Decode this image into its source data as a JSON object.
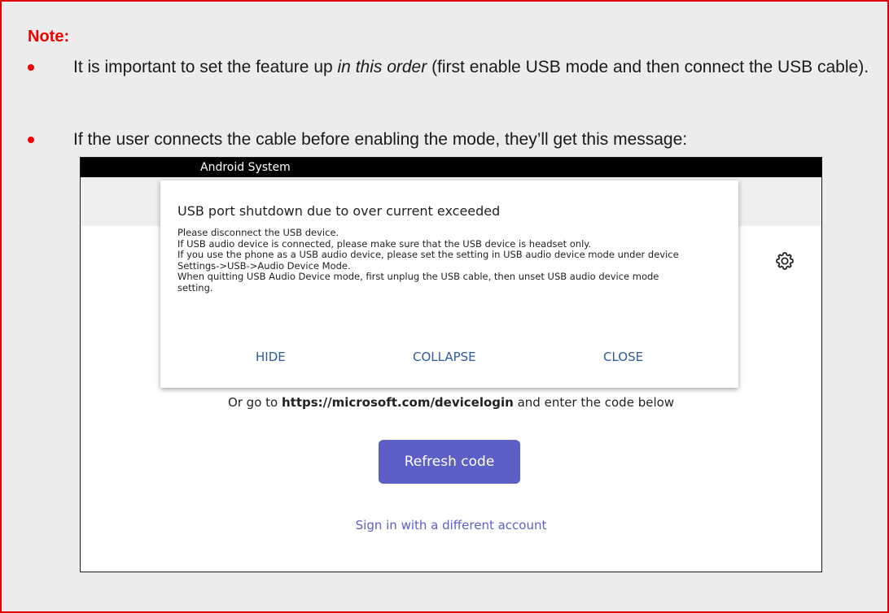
{
  "note": {
    "title": "Note:",
    "bullet1": {
      "pre": "It is important to set the feature up ",
      "italic": "in this order",
      "post": " (first enable USB mode and then connect the USB cable)."
    },
    "bullet2": "If the user connects the cable before enabling the mode, they’ll get this message:"
  },
  "screen": {
    "status_title": "Android System",
    "dialog": {
      "title": "USB port shutdown due to over current exceeded",
      "body": [
        "Please disconnect the USB device.",
        "If USB audio device is connected, please make sure that the USB device is headset only.",
        "If you use the phone as a USB audio device, please set the setting in USB audio device mode under device",
        "Settings->USB->Audio Device Mode.",
        "When quitting USB Audio Device mode, first unplug the USB cable, then unset USB audio device mode",
        "setting."
      ],
      "buttons": {
        "hide": "HIDE",
        "collapse": "COLLAPSE",
        "close": "CLOSE"
      }
    },
    "goto": {
      "pre": "Or go to ",
      "url": "https://microsoft.com/devicelogin",
      "post": " and enter the code below"
    },
    "refresh_label": "Refresh code",
    "signin_label": "Sign in with a different account",
    "gear_icon": "gear-icon"
  },
  "colors": {
    "note_border": "#e00000",
    "note_accent": "#ee0000",
    "brand": "#5b5fc7",
    "dialog_button": "#2c5b9e"
  }
}
